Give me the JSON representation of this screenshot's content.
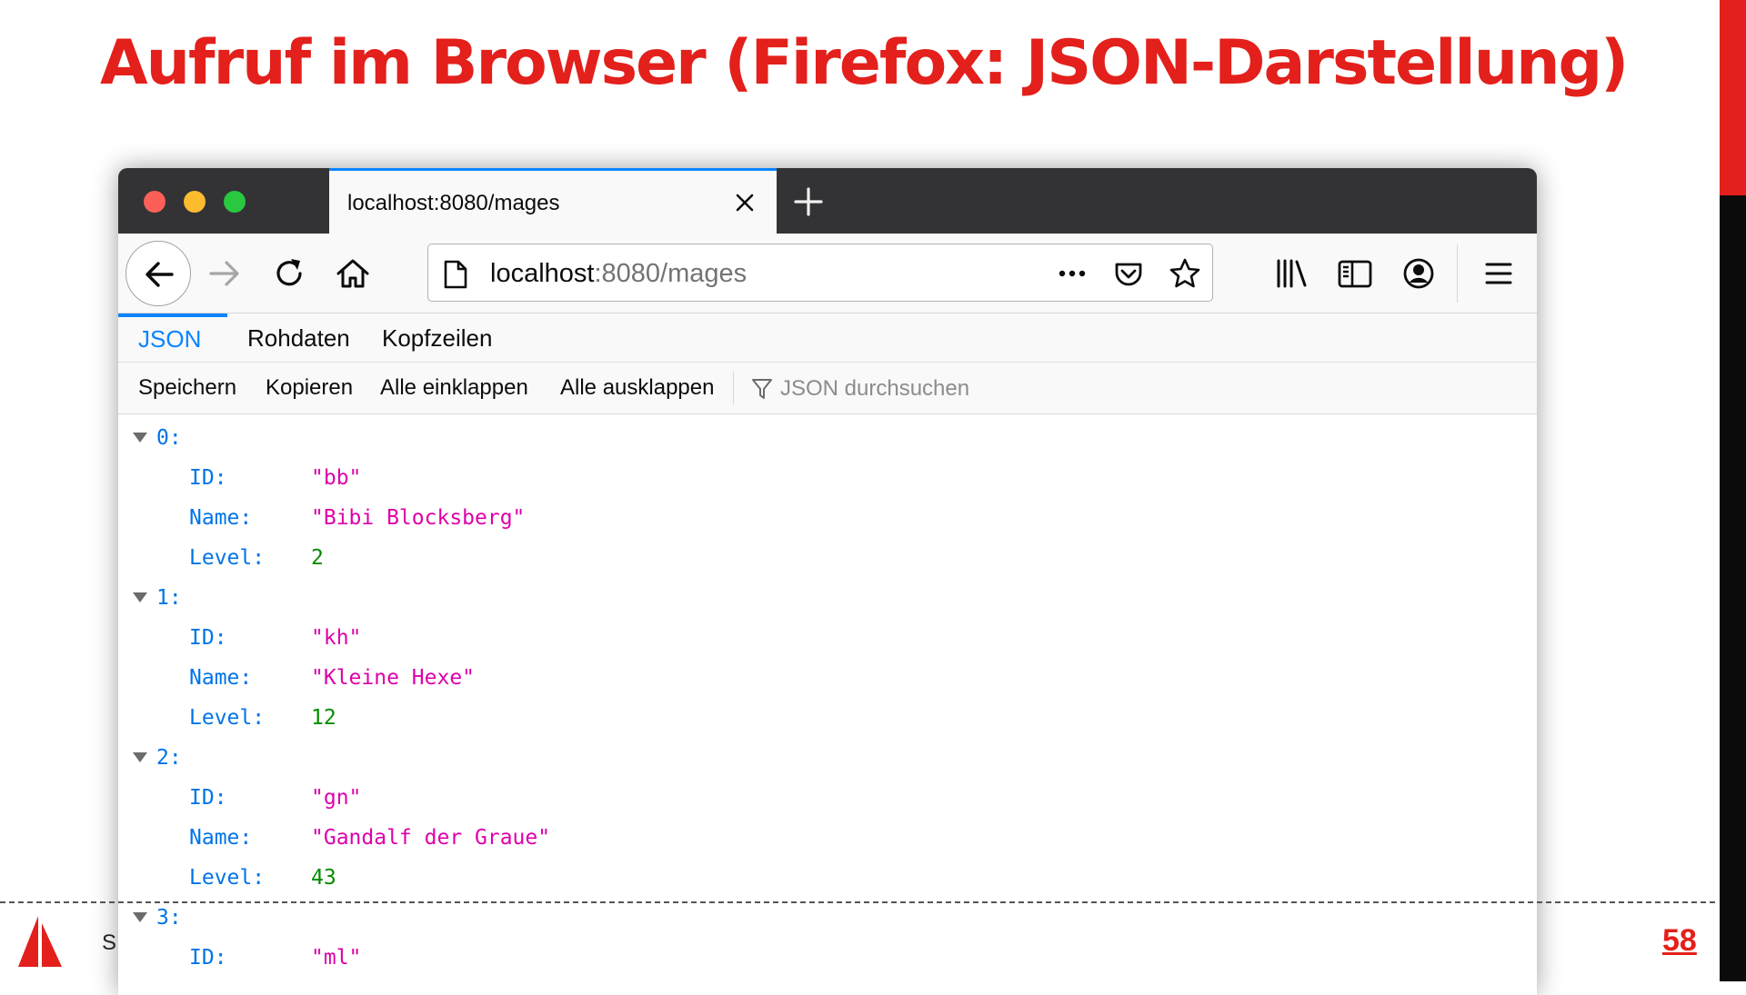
{
  "slide": {
    "title": "Aufruf im Browser (Firefox: JSON-Darstellung)",
    "footer_text": "S",
    "page_number": "58",
    "accent_color": "#e3201b"
  },
  "browser": {
    "tab": {
      "title": "localhost:8080/mages",
      "close_icon": "close-icon"
    },
    "new_tab_icon": "plus-icon",
    "nav": {
      "back_icon": "arrow-left-icon",
      "forward_icon": "arrow-right-icon",
      "reload_icon": "reload-icon",
      "home_icon": "home-icon"
    },
    "url": {
      "host": "localhost",
      "rest": ":8080/mages"
    },
    "url_actions": [
      "more-icon",
      "pocket-icon",
      "star-icon"
    ],
    "toolbar_icons": [
      "library-icon",
      "sidebar-icon",
      "account-icon",
      "menu-icon"
    ]
  },
  "viewer": {
    "tabs": [
      "JSON",
      "Rohdaten",
      "Kopfzeilen"
    ],
    "active_tab": "JSON",
    "toolbar": {
      "save": "Speichern",
      "copy": "Kopieren",
      "collapse_all": "Alle einklappen",
      "expand_all": "Alle ausklappen",
      "filter_placeholder": "JSON durchsuchen"
    },
    "colors": {
      "key": "#0074e8",
      "string": "#dd00a9",
      "number": "#058b00"
    }
  },
  "json": {
    "items": [
      {
        "index": "0:",
        "fields": [
          {
            "key": "ID:",
            "value": "\"bb\"",
            "type": "string"
          },
          {
            "key": "Name:",
            "value": "\"Bibi Blocksberg\"",
            "type": "string"
          },
          {
            "key": "Level:",
            "value": "2",
            "type": "number"
          }
        ]
      },
      {
        "index": "1:",
        "fields": [
          {
            "key": "ID:",
            "value": "\"kh\"",
            "type": "string"
          },
          {
            "key": "Name:",
            "value": "\"Kleine Hexe\"",
            "type": "string"
          },
          {
            "key": "Level:",
            "value": "12",
            "type": "number"
          }
        ]
      },
      {
        "index": "2:",
        "fields": [
          {
            "key": "ID:",
            "value": "\"gn\"",
            "type": "string"
          },
          {
            "key": "Name:",
            "value": "\"Gandalf der Graue\"",
            "type": "string"
          },
          {
            "key": "Level:",
            "value": "43",
            "type": "number"
          }
        ]
      },
      {
        "index": "3:",
        "fields": [
          {
            "key": "ID:",
            "value": "\"ml\"",
            "type": "string"
          }
        ]
      }
    ]
  }
}
